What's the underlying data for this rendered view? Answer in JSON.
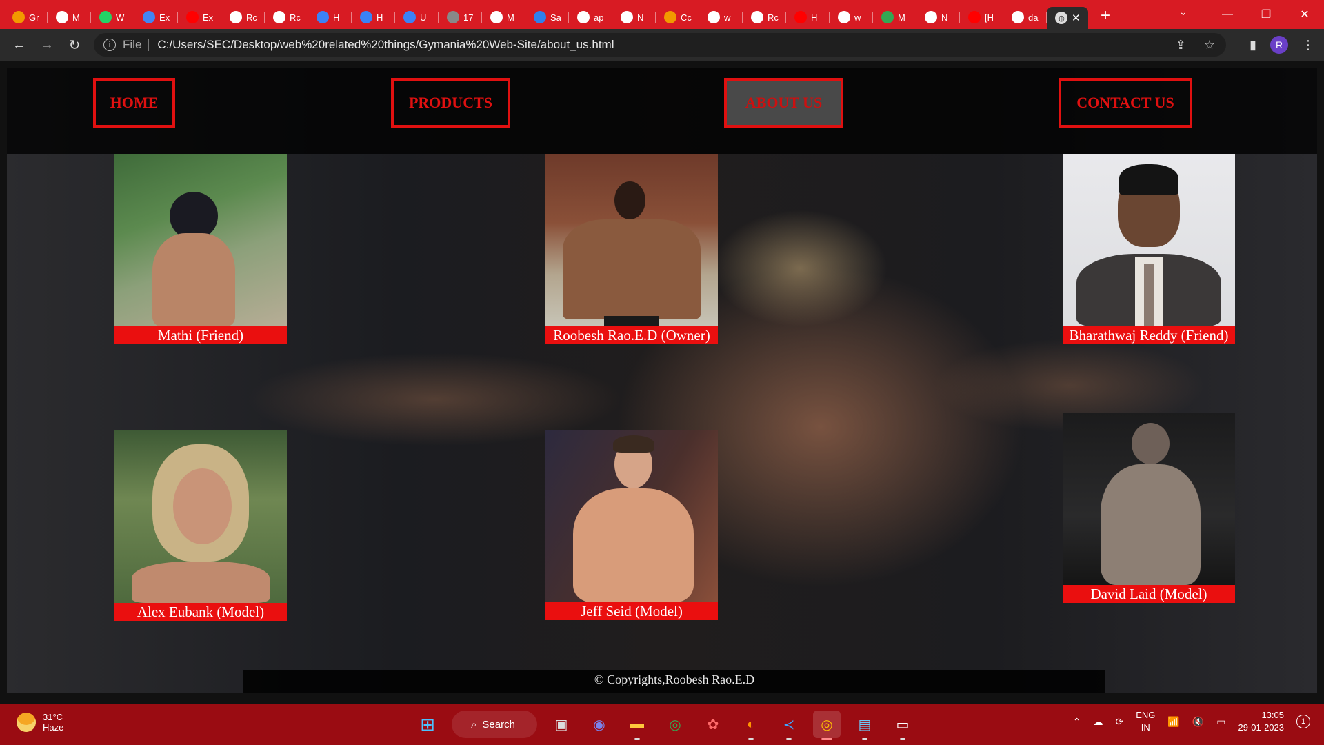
{
  "browser": {
    "tabs": [
      {
        "label": "Gr",
        "icon": "ai-icon",
        "color": "#f29900"
      },
      {
        "label": "M",
        "icon": "github-icon",
        "color": "#ffffff"
      },
      {
        "label": "W",
        "icon": "whatsapp-icon",
        "color": "#25d366"
      },
      {
        "label": "Ex",
        "icon": "docs-icon",
        "color": "#4285f4"
      },
      {
        "label": "Ex",
        "icon": "youtube-icon",
        "color": "#ff0000"
      },
      {
        "label": "Rc",
        "icon": "github-icon",
        "color": "#ffffff"
      },
      {
        "label": "Rc",
        "icon": "github-icon",
        "color": "#ffffff"
      },
      {
        "label": "H",
        "icon": "c-icon",
        "color": "#3b82f6"
      },
      {
        "label": "H",
        "icon": "c-icon",
        "color": "#3b82f6"
      },
      {
        "label": "U",
        "icon": "c-icon",
        "color": "#3b82f6"
      },
      {
        "label": "17",
        "icon": "s-icon",
        "color": "#888888"
      },
      {
        "label": "M",
        "icon": "notion-icon",
        "color": "#ffffff"
      },
      {
        "label": "Sa",
        "icon": "s-icon",
        "color": "#2f80ed"
      },
      {
        "label": "ap",
        "icon": "google-icon",
        "color": "#ffffff"
      },
      {
        "label": "N",
        "icon": "opera-icon",
        "color": "#ffffff"
      },
      {
        "label": "Cc",
        "icon": "ai-icon",
        "color": "#f29900"
      },
      {
        "label": "w",
        "icon": "google-icon",
        "color": "#ffffff"
      },
      {
        "label": "Rc",
        "icon": "github-icon",
        "color": "#ffffff"
      },
      {
        "label": "H",
        "icon": "youtube-icon",
        "color": "#ff0000"
      },
      {
        "label": "w",
        "icon": "google-icon",
        "color": "#ffffff"
      },
      {
        "label": "M",
        "icon": "multicolor-icon",
        "color": "#34a853"
      },
      {
        "label": "N",
        "icon": "opera-icon",
        "color": "#ffffff"
      },
      {
        "label": "[H",
        "icon": "youtube-icon",
        "color": "#ff0000"
      },
      {
        "label": "da",
        "icon": "google-icon",
        "color": "#ffffff"
      }
    ],
    "url_scheme": "File",
    "url": "C:/Users/SEC/Desktop/web%20related%20things/Gymania%20Web-Site/about_us.html",
    "profile_initial": "R"
  },
  "nav": {
    "home": "HOME",
    "products": "PRODUCTS",
    "about": "ABOUT US",
    "contact": "CONTACT US"
  },
  "cards": {
    "mathi": "Mathi (Friend)",
    "roobesh": "Roobesh Rao.E.D (Owner)",
    "bharathwaj": "Bharathwaj Reddy (Friend)",
    "alex": "Alex Eubank (Model)",
    "jeff": "Jeff Seid (Model)",
    "david": "David Laid (Model)"
  },
  "footer": "© Copyrights,Roobesh Rao.E.D",
  "taskbar": {
    "temperature": "31°C",
    "weather": "Haze",
    "search": "Search",
    "lang1": "ENG",
    "lang2": "IN",
    "time": "13:05",
    "date": "29-01-2023",
    "notifications": "1"
  },
  "colors": {
    "chrome": "#d81b23",
    "accent": "#ea0f0f",
    "taskbar": "#9a0c12"
  }
}
